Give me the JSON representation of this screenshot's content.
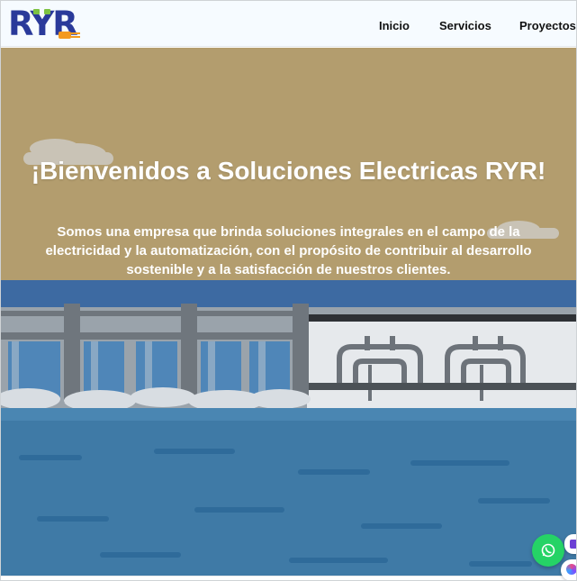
{
  "header": {
    "logo": {
      "letters": [
        "R",
        "Y",
        "R"
      ]
    },
    "nav": [
      {
        "label": "Inicio"
      },
      {
        "label": "Servicios"
      },
      {
        "label": "Proyectos"
      }
    ]
  },
  "hero": {
    "title": "¡Bienvenidos a Soluciones Electricas RYR!",
    "subtitle": "Somos una empresa que brinda soluciones integrales en el campo de la electricidad y la automatización, con el propósito de contribuir al desarrollo sostenible y a la satisfacción de nuestros clientes.",
    "background_icon": "hydro-dam-illustration"
  },
  "floating": {
    "whatsapp_icon": "whatsapp-icon",
    "side_icon_1": "chat-widget-icon",
    "side_icon_2": "assistant-icon"
  },
  "colors": {
    "sky": "#b39d6e",
    "water": "#3f7aa6",
    "dam_wall": "#e6e9ec",
    "dam_stripe": "#3d6aa2",
    "whatsapp": "#25d366",
    "logo_blue": "#2a3a9a",
    "logo_green": "#7cc242",
    "logo_orange": "#f39a1e"
  }
}
